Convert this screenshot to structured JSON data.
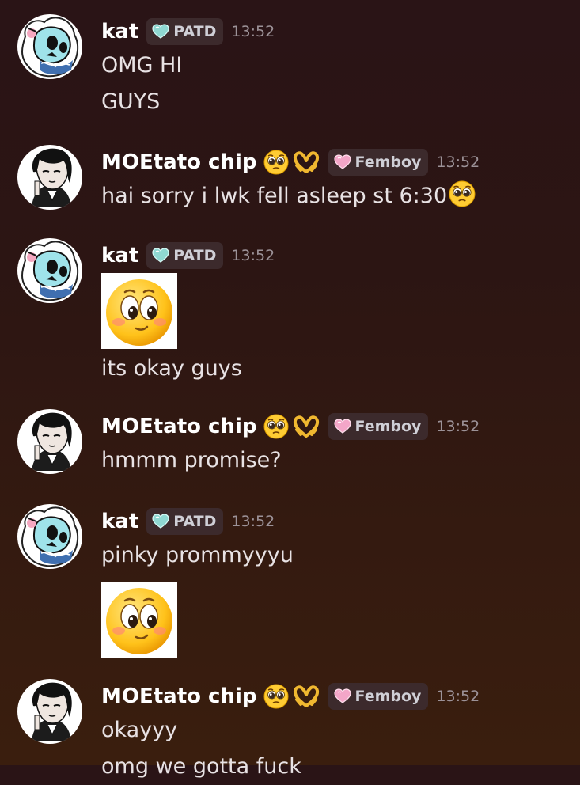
{
  "users": {
    "kat": {
      "name": "kat",
      "tag": "PATD",
      "tag_icon": "heart-icon-teal",
      "tag_color": "#8fd8d2"
    },
    "moe": {
      "name": "MOEtato chip",
      "tag": "Femboy",
      "tag_icon": "heart-icon-pink",
      "tag_color": "#f3a6c8",
      "name_emojis": [
        "pleading-face-emoji",
        "heart-hands-emoji"
      ]
    }
  },
  "messages": [
    {
      "author": "kat",
      "time": "13:52",
      "lines": [
        "OMG HI",
        "GUYS"
      ]
    },
    {
      "author": "MOEtato chip",
      "time": "13:52",
      "lines": [
        "hai sorry i lwk fell asleep st 6:30"
      ],
      "trailing_emoji": "pleading-face-emoji"
    },
    {
      "author": "kat",
      "time": "13:52",
      "sticker": "side-eye-face-emoji",
      "lines": [
        "its okay guys"
      ]
    },
    {
      "author": "MOEtato chip",
      "time": "13:52",
      "lines": [
        "hmmm promise?"
      ]
    },
    {
      "author": "kat",
      "time": "13:52",
      "lines": [
        "pinky prommyyyu"
      ],
      "sticker": "side-eye-face-emoji"
    },
    {
      "author": "MOEtato chip",
      "time": "13:52",
      "lines": [
        "okayyy",
        "omg we gotta fuck"
      ]
    }
  ],
  "colors": {
    "background_top": "#2a1416",
    "background_bottom": "#3a1e0e",
    "tag_bg": "#3c2a2c",
    "timestamp": "#9c9298"
  }
}
